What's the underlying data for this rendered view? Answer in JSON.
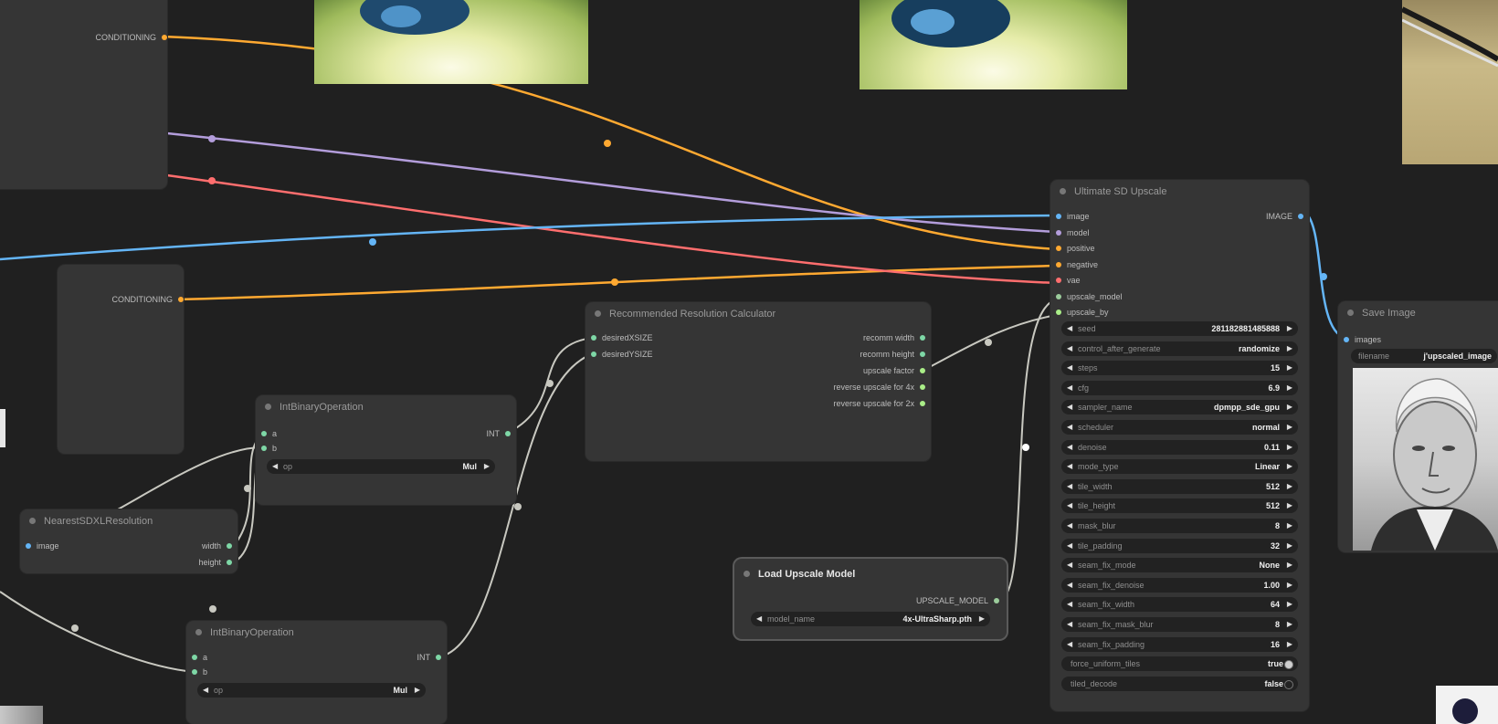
{
  "colors": {
    "background": "#202020",
    "node": "#353535",
    "model": "#b39ddb",
    "positive": "#ffa931",
    "negative": "#ff6e6e",
    "image": "#64b5f6",
    "vae": "#ff6e6e",
    "int": "#7ed7a6",
    "float": "#aaee88",
    "upscale": "#9ccc9c"
  },
  "left_node_top": {
    "output_label": "CONDITIONING"
  },
  "left_node_mid": {
    "output_label": "CONDITIONING"
  },
  "int_op_1": {
    "title": "IntBinaryOperation",
    "inputs": [
      "a",
      "b"
    ],
    "output": "INT",
    "widget_label": "op",
    "widget_value": "Mul"
  },
  "int_op_2": {
    "title": "IntBinaryOperation",
    "inputs": [
      "a",
      "b"
    ],
    "output": "INT",
    "widget_label": "op",
    "widget_value": "Mul"
  },
  "nearest_sdxl": {
    "title": "NearestSDXLResolution",
    "input": "image",
    "outputs": [
      "width",
      "height"
    ]
  },
  "calc": {
    "title": "Recommended Resolution Calculator",
    "inputs": [
      "desiredXSIZE",
      "desiredYSIZE"
    ],
    "outputs": [
      "recomm width",
      "recomm height",
      "upscale factor",
      "reverse upscale for 4x",
      "reverse upscale for 2x"
    ]
  },
  "load_upscale": {
    "title": "Load Upscale Model",
    "output": "UPSCALE_MODEL",
    "widget_label": "model_name",
    "widget_value": "4x-UltraSharp.pth"
  },
  "ultimate": {
    "title": "Ultimate SD Upscale",
    "inputs": [
      "image",
      "model",
      "positive",
      "negative",
      "vae",
      "upscale_model",
      "upscale_by"
    ],
    "output": "IMAGE",
    "widgets": [
      {
        "label": "seed",
        "value": "281182881485888"
      },
      {
        "label": "control_after_generate",
        "value": "randomize"
      },
      {
        "label": "steps",
        "value": "15"
      },
      {
        "label": "cfg",
        "value": "6.9"
      },
      {
        "label": "sampler_name",
        "value": "dpmpp_sde_gpu"
      },
      {
        "label": "scheduler",
        "value": "normal"
      },
      {
        "label": "denoise",
        "value": "0.11"
      },
      {
        "label": "mode_type",
        "value": "Linear"
      },
      {
        "label": "tile_width",
        "value": "512"
      },
      {
        "label": "tile_height",
        "value": "512"
      },
      {
        "label": "mask_blur",
        "value": "8"
      },
      {
        "label": "tile_padding",
        "value": "32"
      },
      {
        "label": "seam_fix_mode",
        "value": "None"
      },
      {
        "label": "seam_fix_denoise",
        "value": "1.00"
      },
      {
        "label": "seam_fix_width",
        "value": "64"
      },
      {
        "label": "seam_fix_mask_blur",
        "value": "8"
      },
      {
        "label": "seam_fix_padding",
        "value": "16"
      }
    ],
    "toggles": [
      {
        "label": "force_uniform_tiles",
        "value": "true"
      },
      {
        "label": "tiled_decode",
        "value": "false"
      }
    ]
  },
  "save_image": {
    "title": "Save Image",
    "input": "images",
    "widget_label": "filename",
    "widget_value": "j'upscaled_image"
  }
}
